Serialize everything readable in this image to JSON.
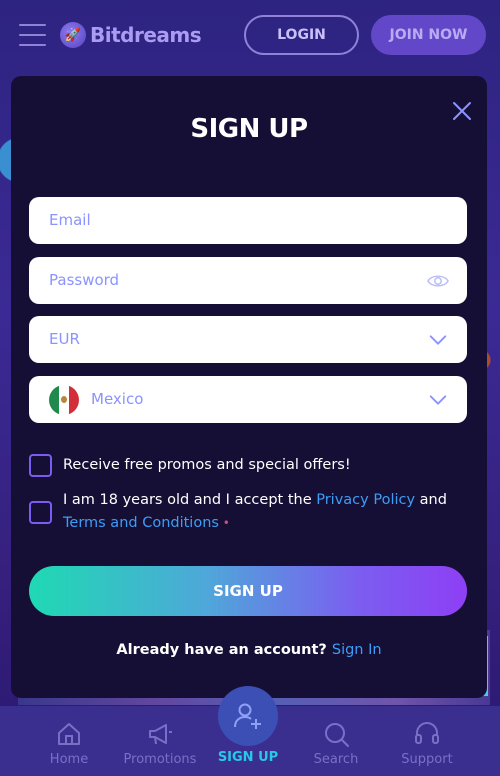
{
  "header": {
    "logo_text": "Bitdreams",
    "login_label": "LOGIN",
    "join_label": "JOIN NOW"
  },
  "modal": {
    "title": "SIGN UP",
    "email_placeholder": "Email",
    "password_placeholder": "Password",
    "currency_value": "EUR",
    "country_value": "Mexico",
    "promos_label": "Receive free promos and special offers!",
    "terms_prefix": "I am 18 years old and I accept the ",
    "privacy_link": "Privacy Policy",
    "terms_and": " and",
    "terms_link": "Terms and Conditions",
    "terms_star": " •",
    "signup_button": "SIGN UP",
    "already_text": "Already have an account?",
    "signin_link": "Sign In"
  },
  "bottom_nav": {
    "home": "Home",
    "promotions": "Promotions",
    "signup": "SIGN UP",
    "search": "Search",
    "support": "Support"
  },
  "colors": {
    "accent": "#8a93ff",
    "link": "#3e9cf5",
    "modal_bg": "#150f35",
    "active_nav": "#28c8e8"
  },
  "icons": [
    "menu-icon",
    "rocket-icon",
    "close-icon",
    "eye-icon",
    "chevron-down-icon",
    "mexico-flag-icon",
    "home-icon",
    "megaphone-icon",
    "add-user-icon",
    "search-icon",
    "headset-icon"
  ]
}
